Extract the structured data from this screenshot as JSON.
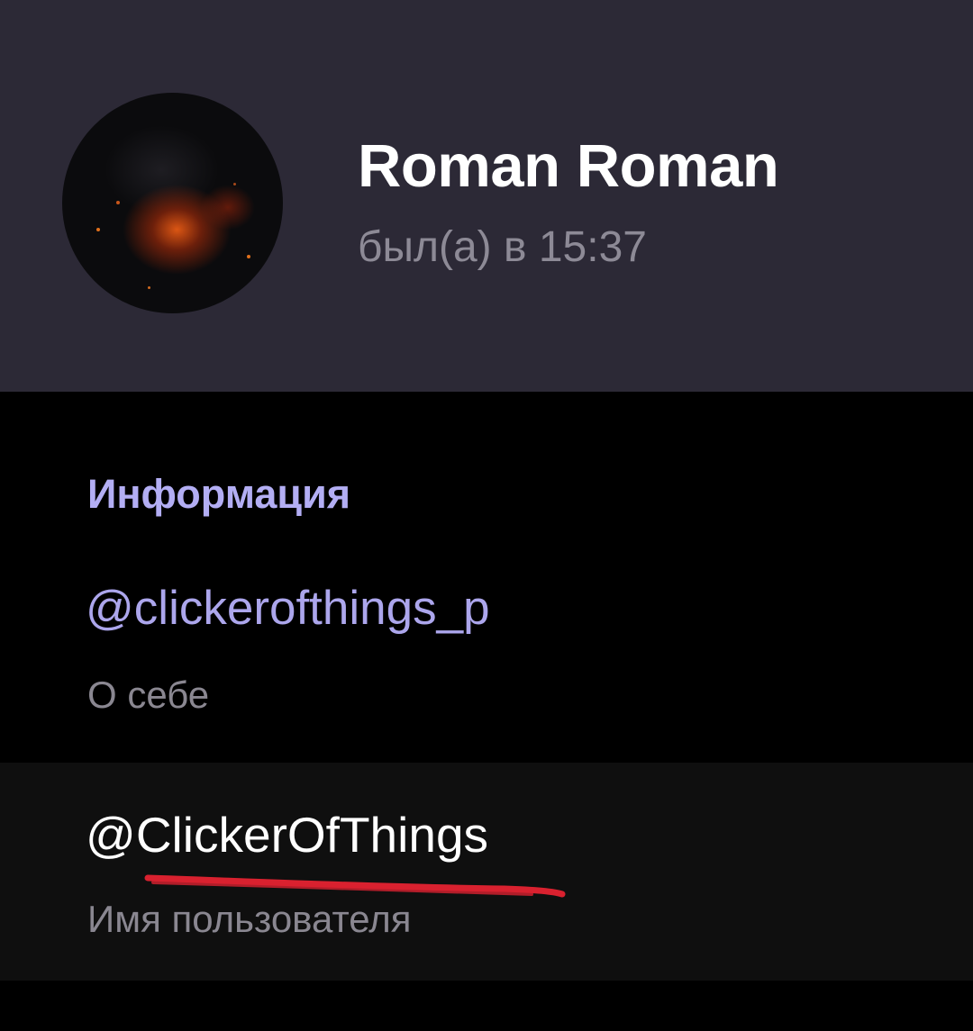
{
  "profile": {
    "name": "Roman Roman",
    "status": "был(а) в 15:37",
    "avatar_icon": "user-avatar-photo"
  },
  "info": {
    "title": "Информация",
    "bio": "@clickerofthings_p",
    "bio_label": "О себе",
    "username": "@ClickerOfThings",
    "username_label": "Имя пользователя"
  },
  "colors": {
    "header_bg": "#2c2936",
    "accent": "#b3aef4",
    "link": "#aca6ec",
    "secondary_text": "#8a8791",
    "annotation": "#d9212f"
  }
}
